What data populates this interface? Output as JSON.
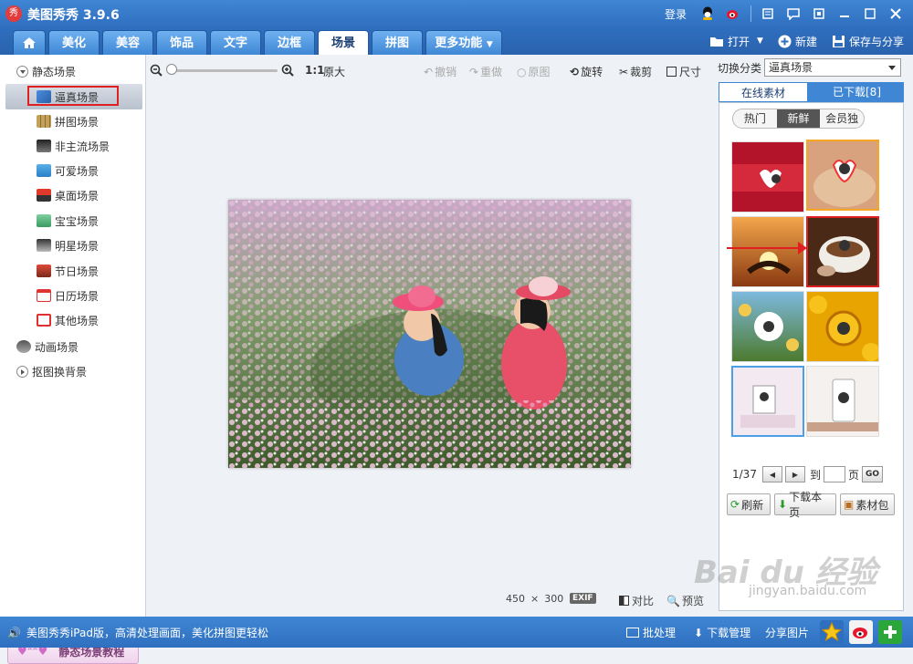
{
  "app": {
    "title": "美图秀秀 3.9.6",
    "logo_char": "秀"
  },
  "titlebar": {
    "login": "登录"
  },
  "tabs": [
    "美化",
    "美容",
    "饰品",
    "文字",
    "边框",
    "场景",
    "拼图",
    "更多功能"
  ],
  "active_tab": "场景",
  "actions": {
    "open": "打开",
    "new": "新建",
    "save": "保存与分享"
  },
  "tree": {
    "root_static": "静态场景",
    "items": [
      "逼真场景",
      "拼图场景",
      "非主流场景",
      "可爱场景",
      "桌面场景",
      "宝宝场景",
      "明星场景",
      "节日场景",
      "日历场景",
      "其他场景"
    ],
    "selected": "逼真场景",
    "animated": "动画场景",
    "cutout": "抠图换背景"
  },
  "tutorial": "静态场景教程",
  "toolbar": {
    "zoom_ratio": "1:1",
    "original": "原大",
    "undo": "撤销",
    "redo": "重做",
    "reset": "原图",
    "rotate": "旋转",
    "crop": "裁剪",
    "size": "尺寸"
  },
  "image_info": {
    "width": "450",
    "times": "×",
    "height": "300",
    "exif": "EXIF",
    "compare": "对比",
    "preview": "预览"
  },
  "right": {
    "switch_label": "切换分类",
    "switch_value": "逼真场景",
    "tab_online": "在线素材",
    "tab_downloaded": "已下载[8]",
    "subtabs": [
      "热门",
      "新鲜",
      "会员独享"
    ],
    "active_subtab": "新鲜",
    "page": "1/37",
    "to": "到",
    "page_unit": "页",
    "go": "GO",
    "refresh": "刷新",
    "download_page": "下载本页",
    "material_pack": "素材包"
  },
  "status": {
    "ipad_msg": "美图秀秀iPad版，高清处理画面，美化拼图更轻松",
    "batch": "批处理",
    "download_mgr": "下载管理",
    "share": "分享图片"
  },
  "watermark": {
    "logo": "Bai du 经验",
    "url": "jingyan.baidu.com"
  }
}
